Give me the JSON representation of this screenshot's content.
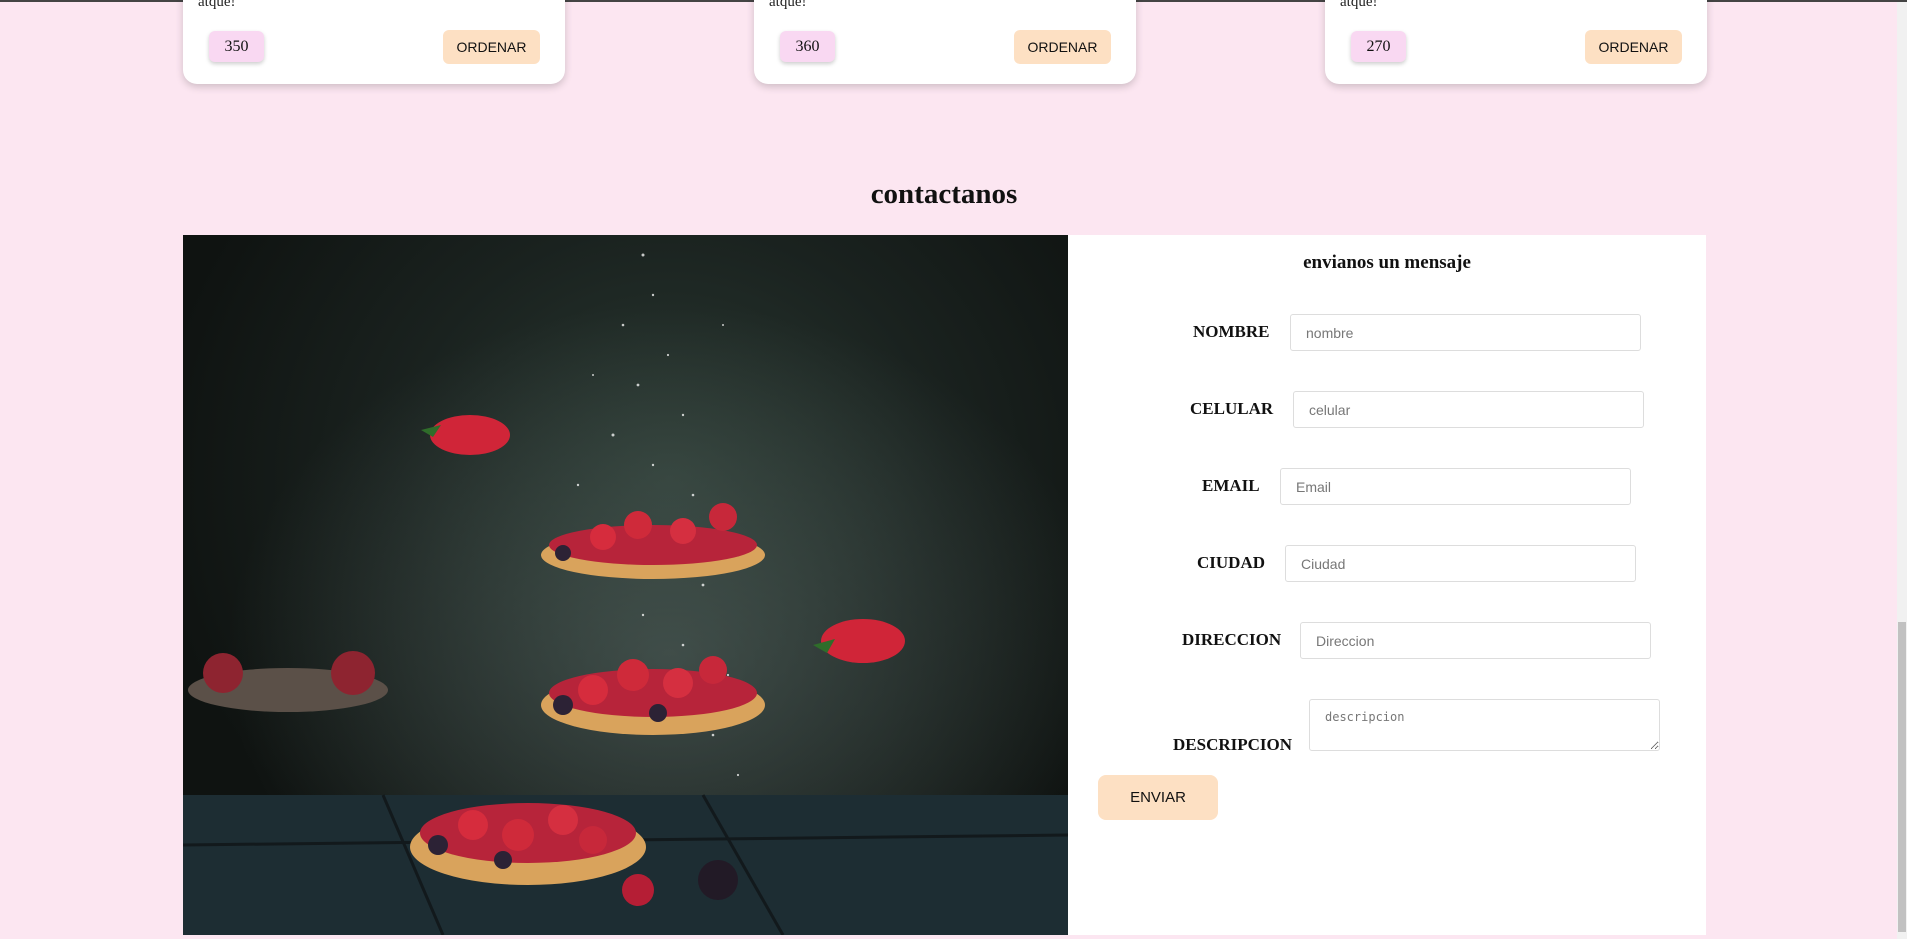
{
  "products": [
    {
      "snippet": "atque!",
      "price": "350",
      "order_label": "ORDENAR"
    },
    {
      "snippet": "atque!",
      "price": "360",
      "order_label": "ORDENAR"
    },
    {
      "snippet": "atque!",
      "price": "270",
      "order_label": "ORDENAR"
    }
  ],
  "contact": {
    "section_title": "contactanos",
    "form_title": "envianos un mensaje",
    "fields": [
      {
        "label": "NOMBRE",
        "placeholder": "nombre"
      },
      {
        "label": "CELULAR",
        "placeholder": "celular"
      },
      {
        "label": "EMAIL",
        "placeholder": "Email"
      },
      {
        "label": "CIUDAD",
        "placeholder": "Ciudad"
      },
      {
        "label": "DIRECCION",
        "placeholder": "Direccion"
      },
      {
        "label": "DESCRIPCION",
        "placeholder": "descripcion"
      }
    ],
    "submit_label": "ENVIAR"
  },
  "colors": {
    "page_bg": "#fce6f1",
    "price_badge": "#f9d8f2",
    "button_bg": "#fde0c3"
  }
}
